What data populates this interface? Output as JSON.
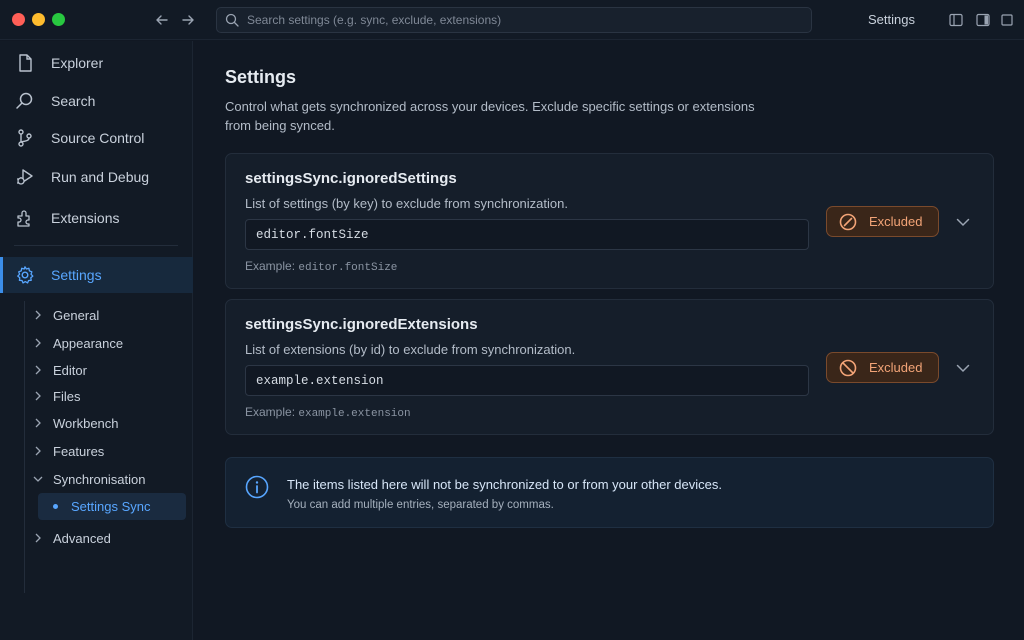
{
  "titlebar": {
    "search_placeholder": "Search settings (e.g. sync, exclude, extensions)",
    "title": "Settings"
  },
  "sidebar": {
    "items": [
      {
        "label": "Explorer",
        "icon": "file-icon"
      },
      {
        "label": "Search",
        "icon": "search-icon"
      },
      {
        "label": "Source Control",
        "icon": "source-control-icon"
      },
      {
        "label": "Run and Debug",
        "icon": "run-debug-icon"
      },
      {
        "label": "Extensions",
        "icon": "extensions-icon"
      }
    ],
    "active": {
      "label": "Settings",
      "icon": "gear-icon"
    },
    "tree": [
      {
        "label": "General",
        "expanded": false
      },
      {
        "label": "Appearance",
        "expanded": false
      },
      {
        "label": "Editor",
        "expanded": false
      },
      {
        "label": "Files",
        "expanded": false
      },
      {
        "label": "Workbench",
        "expanded": false
      },
      {
        "label": "Features",
        "expanded": false
      },
      {
        "label": "Synchronisation",
        "expanded": true
      },
      {
        "label": "Advanced",
        "expanded": false
      }
    ],
    "tree_selected": "Settings Sync"
  },
  "main": {
    "title": "Settings",
    "description": "Control what gets synchronized across your devices. Exclude specific settings or extensions from being synced.",
    "cards": [
      {
        "title": "settingsSync.ignoredSettings",
        "description": "List of settings (by key) to exclude from synchronization.",
        "value": "editor.fontSize",
        "example_label": "Example:",
        "example_value": "editor.fontSize",
        "status_label": "Excluded"
      },
      {
        "title": "settingsSync.ignoredExtensions",
        "description": "List of extensions (by id) to exclude from synchronization.",
        "value": "example.extension",
        "example_label": "Example:",
        "example_value": "example.extension",
        "status_label": "Excluded"
      }
    ],
    "info": {
      "main": "The items listed here will not be synchronized to or from your other devices.",
      "sub": "You can add multiple entries, separated by commas."
    }
  },
  "colors": {
    "accent": "#58a6ff",
    "excluded_bg": "#3a2619",
    "excluded_text": "#f3a477",
    "background": "#111823"
  }
}
